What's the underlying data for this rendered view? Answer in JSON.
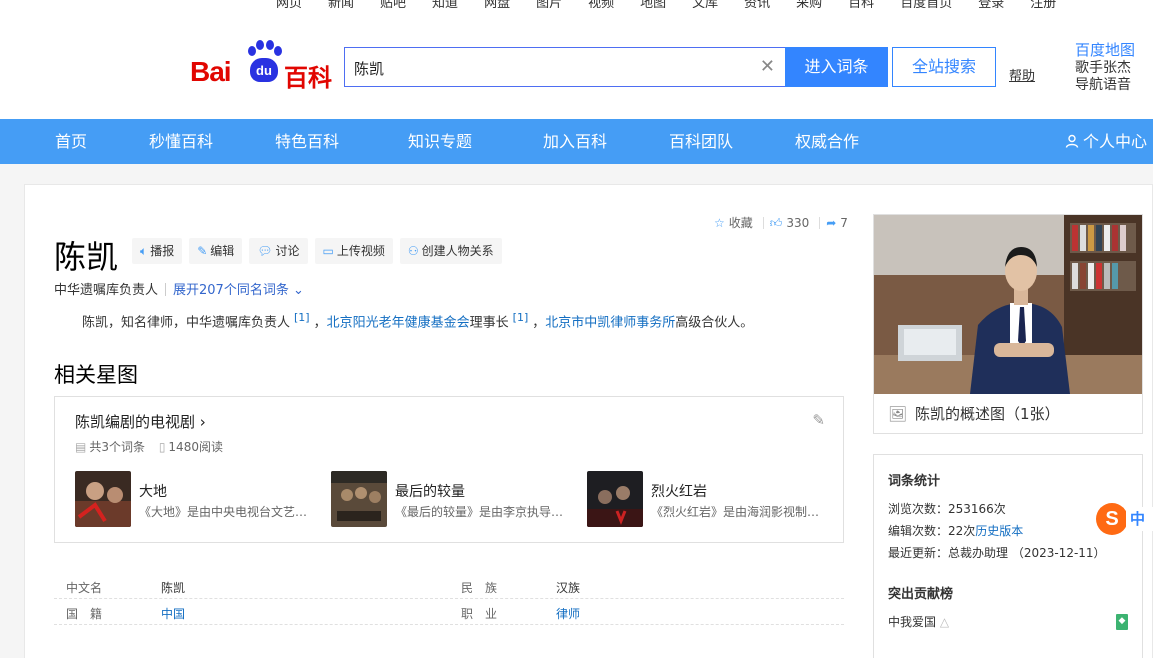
{
  "top_links": [
    "网页",
    "新闻",
    "贴吧",
    "知道",
    "网盘",
    "图片",
    "视频",
    "地图",
    "文库",
    "资讯",
    "采购",
    "百科"
  ],
  "top_right": [
    "百度首页",
    "登录",
    "注册"
  ],
  "header": {
    "logo_bai": "Bai",
    "logo_du": "du",
    "logo_baike": "百科",
    "search_value": "陈凯",
    "enter_button": "进入词条",
    "site_search_button": "全站搜索",
    "help": "帮助",
    "ad_title": "百度地图",
    "ad_line1": "歌手张杰",
    "ad_line2": "导航语音"
  },
  "nav": [
    "首页",
    "秒懂百科",
    "特色百科",
    "知识专题",
    "加入百科",
    "百科团队",
    "权威合作"
  ],
  "nav_user": "个人中心",
  "actions": {
    "collect": "收藏",
    "likes": "330",
    "shares": "7"
  },
  "entry": {
    "title": "陈凯",
    "tools": [
      "播报",
      "编辑",
      "讨论",
      "上传视频",
      "创建人物关系"
    ],
    "subtitle": "中华遗嘱库负责人",
    "more_same_name": "展开207个同名词条",
    "summary": {
      "p1": "陈凯，知名律师，中华遗嘱库负责人",
      "ref1": "[1]",
      "link1": "北京阳光老年健康基金会",
      "p2": "理事长",
      "ref2": "[1]",
      "link2": "北京市中凯律师事务所",
      "p3": "高级合伙人。"
    }
  },
  "star_map": {
    "section_title": "相关星图",
    "card_title": "陈凯编剧的电视剧",
    "count": "共3个词条",
    "views": "1480阅读",
    "dramas": [
      {
        "title": "大地",
        "desc": "《大地》是由中央电视台文艺中心影视部出品"
      },
      {
        "title": "最后的较量",
        "desc": "《最后的较量》是由李京执导的电视剧"
      },
      {
        "title": "烈火红岩",
        "desc": "《烈火红岩》是由海润影视制作的电视剧"
      }
    ]
  },
  "info": {
    "rows": [
      {
        "k1": "中文名",
        "v1": "陈凯",
        "k2": "民　族",
        "v2": "汉族"
      },
      {
        "k1": "国　籍",
        "v1": "中国",
        "k2": "职　业",
        "v2": "律师"
      }
    ]
  },
  "photo": {
    "caption": "陈凯的概述图（1张）"
  },
  "stats": {
    "title": "词条统计",
    "views": "浏览次数：253166次",
    "edits": "编辑次数：22次",
    "history": "历史版本",
    "updated": "最近更新：总裁办助理 （2023-12-11）",
    "contrib_title": "突出贡献榜",
    "contributor": "中我爱国"
  },
  "sogou": {
    "s": "S",
    "zh": "中"
  },
  "colors": {
    "nav_bg": "#459df5",
    "brand_red": "#e10601",
    "brand_blue": "#2932e1",
    "link": "#136ec2"
  }
}
